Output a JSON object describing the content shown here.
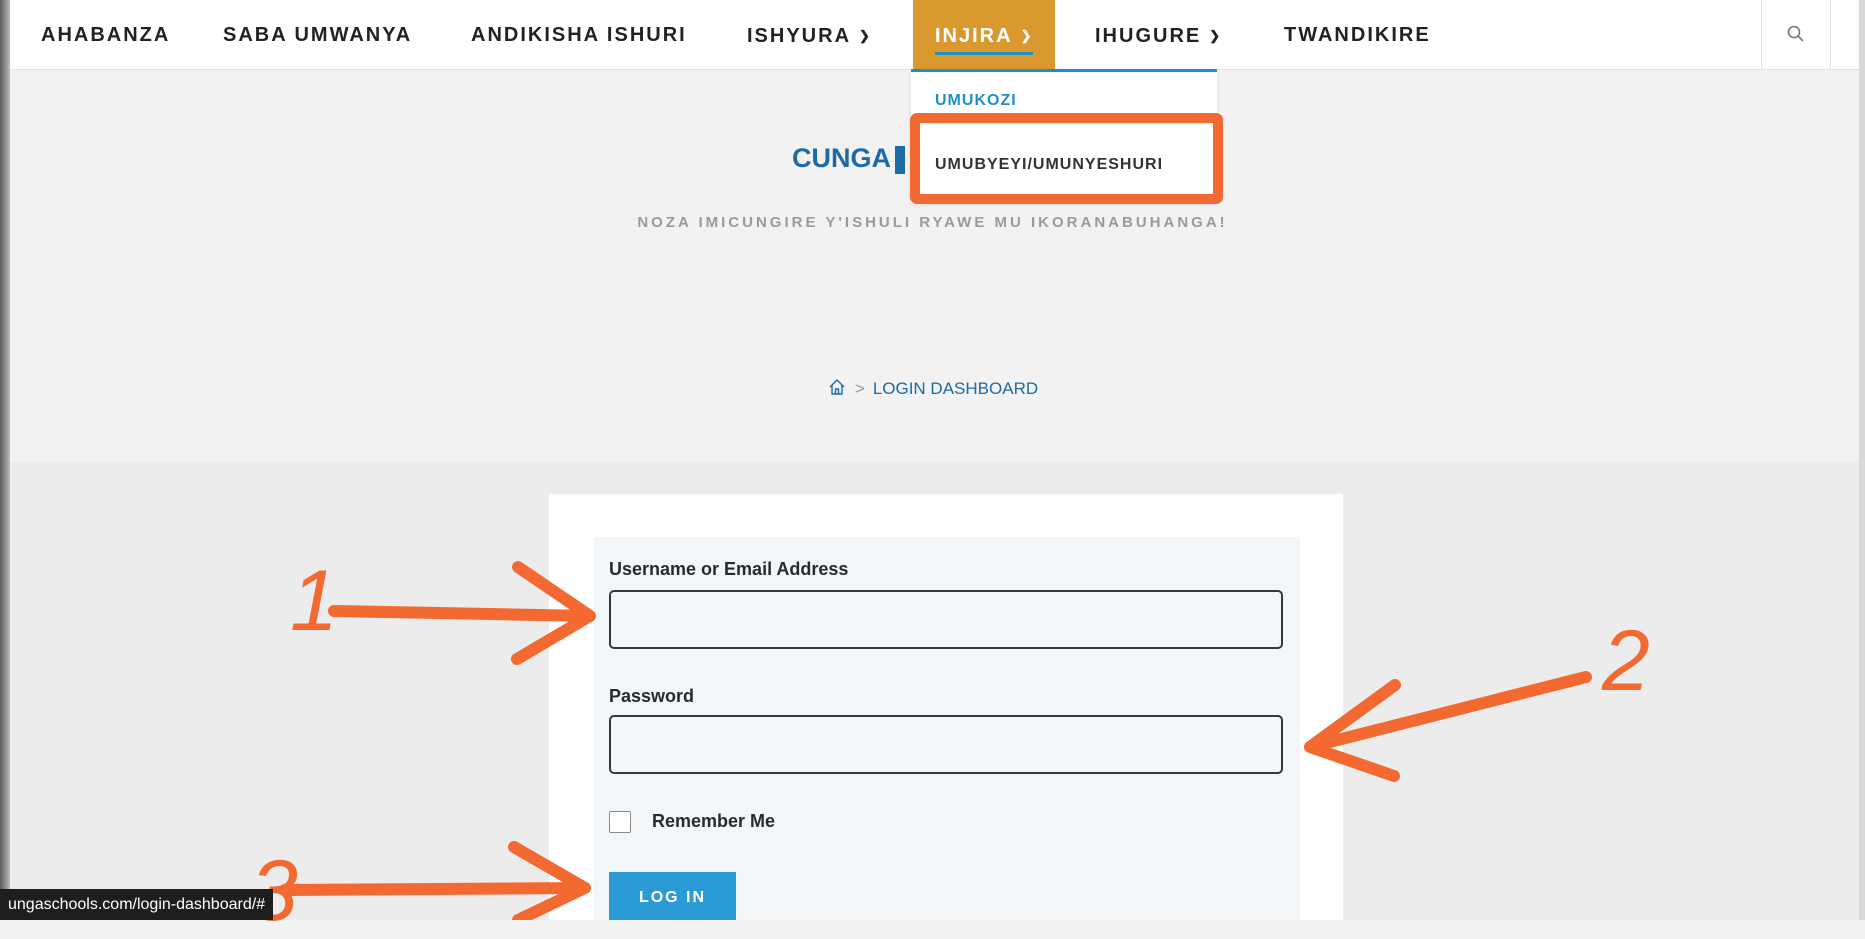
{
  "nav": {
    "items": [
      {
        "label": "AHABANZA"
      },
      {
        "label": "SABA UMWANYA"
      },
      {
        "label": "ANDIKISHA ISHURI"
      },
      {
        "label": "ISHYURA"
      },
      {
        "label": "INJIRA"
      },
      {
        "label": "IHUGURE"
      },
      {
        "label": "TWANDIKIRE"
      }
    ],
    "active_item": "INJIRA",
    "accent_color": "#d9992e",
    "search_icon": "search-icon"
  },
  "dropdown": {
    "items": [
      {
        "label": "UMUKOZI"
      },
      {
        "label": "UMUBYEYI/UMUNYESHURI"
      }
    ]
  },
  "header": {
    "title": "CUNGA",
    "subtitle": "NOZA IMICUNGIRE Y'ISHULI RYAWE MU IKORANABUHANGA!"
  },
  "breadcrumb": {
    "home_icon": "home-icon",
    "separator": ">",
    "current": "LOGIN DASHBOARD"
  },
  "login_form": {
    "username_label": "Username or Email Address",
    "username_value": "",
    "password_label": "Password",
    "password_value": "",
    "remember_label": "Remember Me",
    "remember_checked": false,
    "submit_label": "LOG IN"
  },
  "annotations": {
    "step1": "1",
    "step2": "2",
    "step3": "3",
    "color": "#f26a32"
  },
  "statusbar": {
    "url": "ungaschools.com/login-dashboard/#"
  }
}
